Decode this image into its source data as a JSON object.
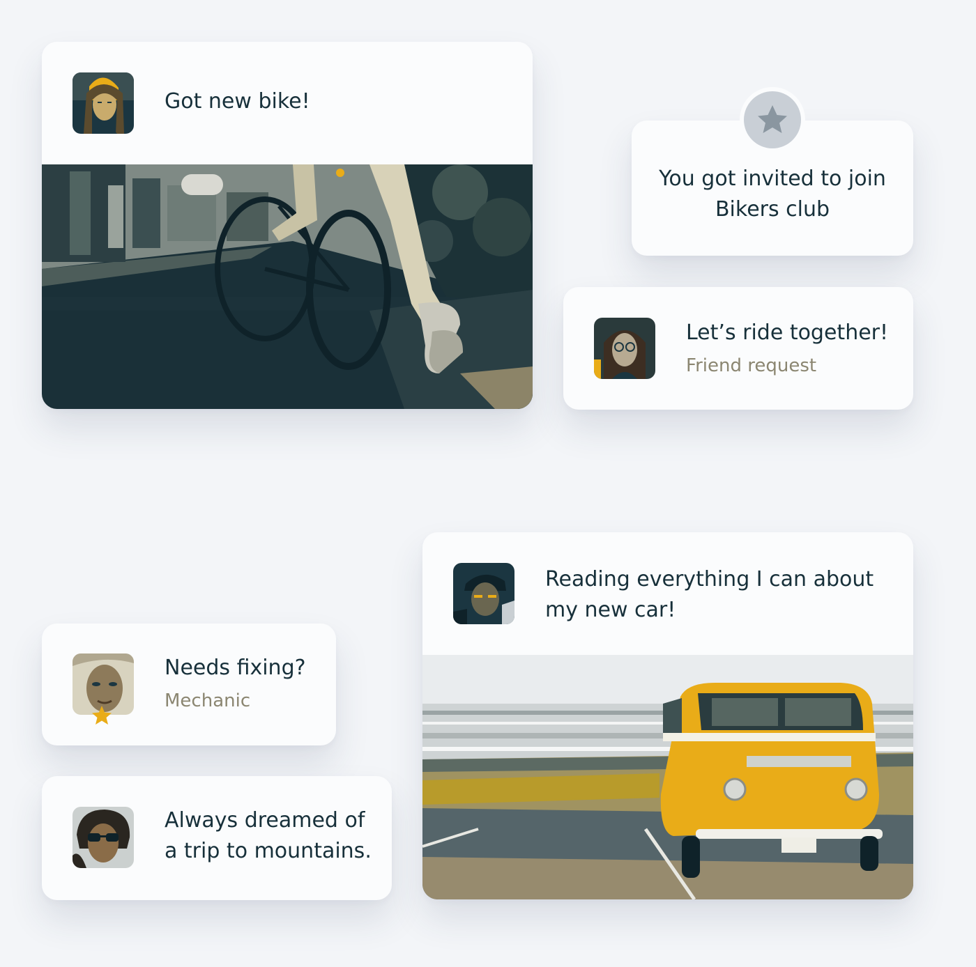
{
  "posts": [
    {
      "text": "Got new bike!"
    },
    {
      "text": "Reading everything I can about my new car!"
    }
  ],
  "notifications": {
    "invite": {
      "text": "You got invited to join Bikers club",
      "icon": "star-icon"
    },
    "friend_request": {
      "title": "Let’s ride together!",
      "subtitle": "Friend request"
    },
    "mechanic": {
      "title": "Needs fixing?",
      "subtitle": "Mechanic",
      "badge_icon": "star-icon"
    },
    "dream": {
      "text": "Always dreamed of a trip to mountains."
    }
  },
  "colors": {
    "accent": "#e9ac18",
    "dark": "#17303a",
    "muted": "#8b8671",
    "background": "#f3f5f8"
  }
}
